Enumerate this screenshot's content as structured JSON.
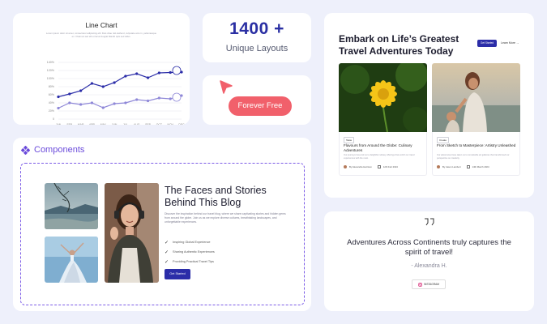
{
  "line_chart_card": {
    "title": "Line Chart",
    "subtitle": "Lorem ipsum dolor sit amet, consectetur adipiscing elit. Duis vitae nisl eleifend, vulputate arcu in, pellentesque ex. Vivamus sed elit et lacus feugiat blandit quis sed tellus."
  },
  "chart_data": {
    "type": "line",
    "title": "Line Chart",
    "categories": [
      "JAN",
      "FEB",
      "MAR",
      "APR",
      "MAY",
      "JUN",
      "JUL",
      "AUG",
      "SEP",
      "OCT",
      "NOV",
      "DEC"
    ],
    "y_ticks": [
      "0",
      "20%",
      "40%",
      "60%",
      "80%",
      "100%",
      "120%",
      "140%"
    ],
    "ylim": [
      0,
      140
    ],
    "grid": true,
    "series": [
      {
        "color": "#2b2da8",
        "values": [
          55,
          62,
          70,
          88,
          80,
          90,
          106,
          112,
          102,
          114,
          115,
          116
        ]
      },
      {
        "color": "#8f88d8",
        "values": [
          27,
          40,
          36,
          40,
          28,
          38,
          40,
          48,
          45,
          52,
          50,
          58
        ]
      }
    ],
    "icons": [
      "bag-icon",
      "heart-icon"
    ]
  },
  "stat": {
    "value": "1400 +",
    "label": "Unique Layouts"
  },
  "free": {
    "label": "Forever Free",
    "accent": "#f1606b"
  },
  "components": {
    "heading": "Components",
    "blog_title": "The Faces and Stories Behind This Blog",
    "blog_desc": "Discover the inspiration behind our travel blog, where we share captivating stories and hidden gems from around the globe. Join us as we explore diverse cultures, breathtaking landscapes, and unforgettable experiences.",
    "checks": [
      "Inspiring Global Experience",
      "Sharing Authentic Experiences",
      "Providing Practical Travel Tips"
    ],
    "button": "Get Started"
  },
  "travel": {
    "title": "Embark on Life’s Greatest Travel Adventures Today",
    "get_started": "Get Started",
    "learn_more": "Learn More →",
    "posts": [
      {
        "tag": "Taste",
        "title": "Flavours from Around the Globe: Culinary Adventures",
        "desc": "Our journeys have led us to delightful culinary offerings that enrich our travel experiences with the most.",
        "author": "By Alexandra Harrison",
        "date": "12th Feb 2024"
      },
      {
        "tag": "Create",
        "title": "From Sketch to Masterpiece: Artistry Unleashed",
        "desc": "Our adventures have taken us to remarkable art galleries that transformed our perspective on creativity.",
        "author": "By Jason Lambert",
        "date": "14th March 2024"
      }
    ]
  },
  "testimonial": {
    "quote": "Adventures Across Continents truly captures the spirit of travel!",
    "author": "- Alexandra H.",
    "social": "INSTAGRAM"
  },
  "colors": {
    "background": "#eef0fb",
    "brand": "#2b2da8",
    "accent_purple": "#7c5ce6"
  }
}
